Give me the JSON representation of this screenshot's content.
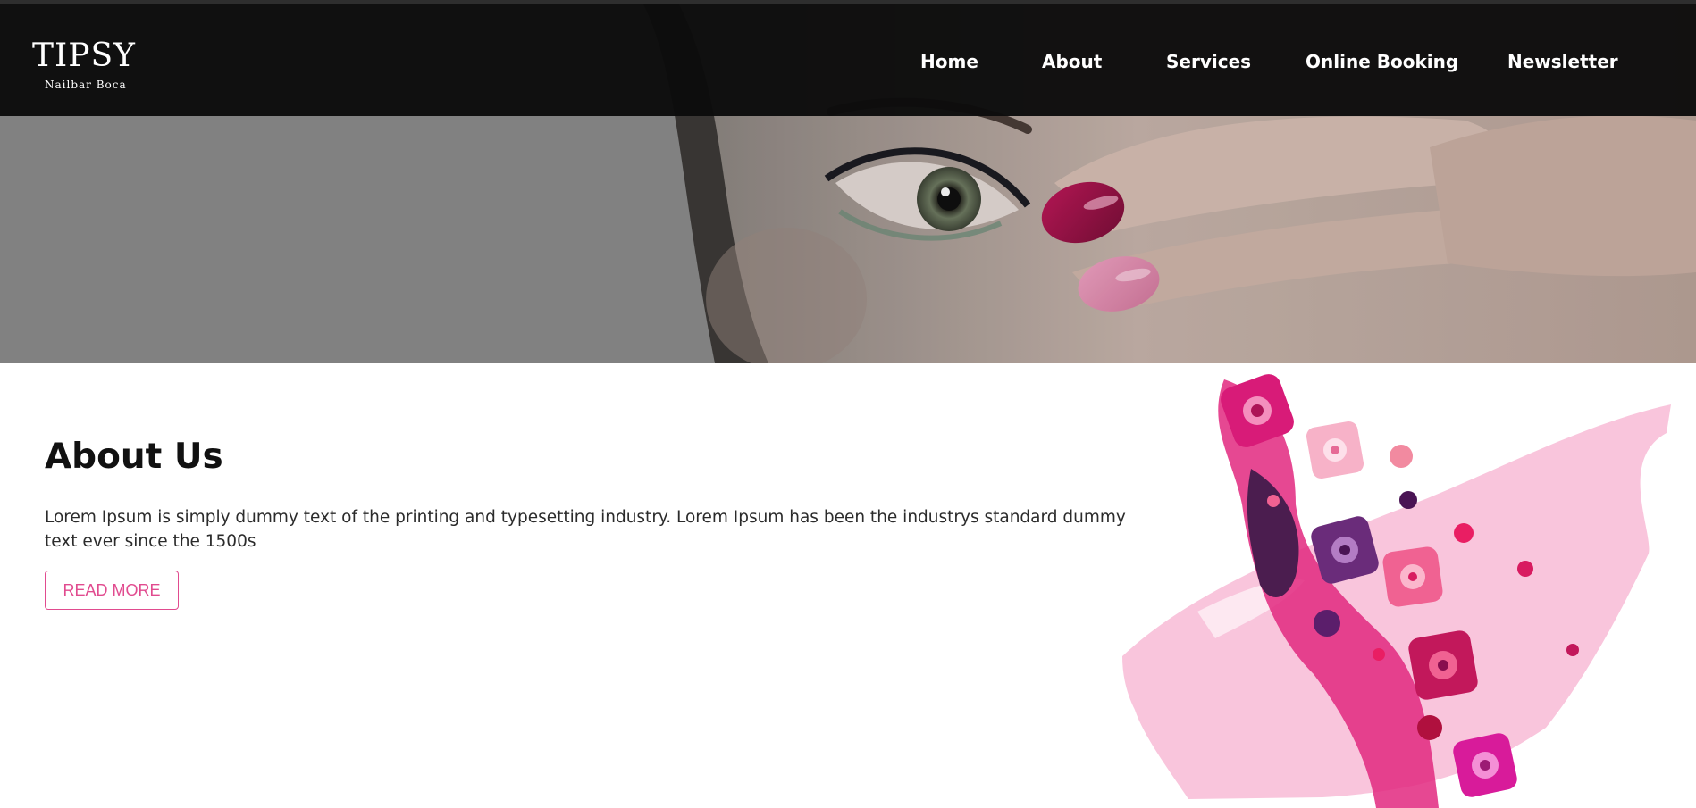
{
  "header": {
    "logo": {
      "title": "TIPSY",
      "subtitle": "Nailbar Boca"
    },
    "nav": [
      {
        "label": "Home"
      },
      {
        "label": "About"
      },
      {
        "label": "Services"
      },
      {
        "label": "Online Booking"
      },
      {
        "label": "Newsletter"
      }
    ]
  },
  "about": {
    "title": "About Us",
    "text": "Lorem Ipsum is simply dummy text of the printing and typesetting industry. Lorem Ipsum has been the industrys standard dummy text ever since the 1500s",
    "button_label": "READ MORE"
  },
  "colors": {
    "header_bg": "#0c0c0c",
    "accent": "#e14b8f",
    "hero_overlay": "#8f8f8f"
  }
}
